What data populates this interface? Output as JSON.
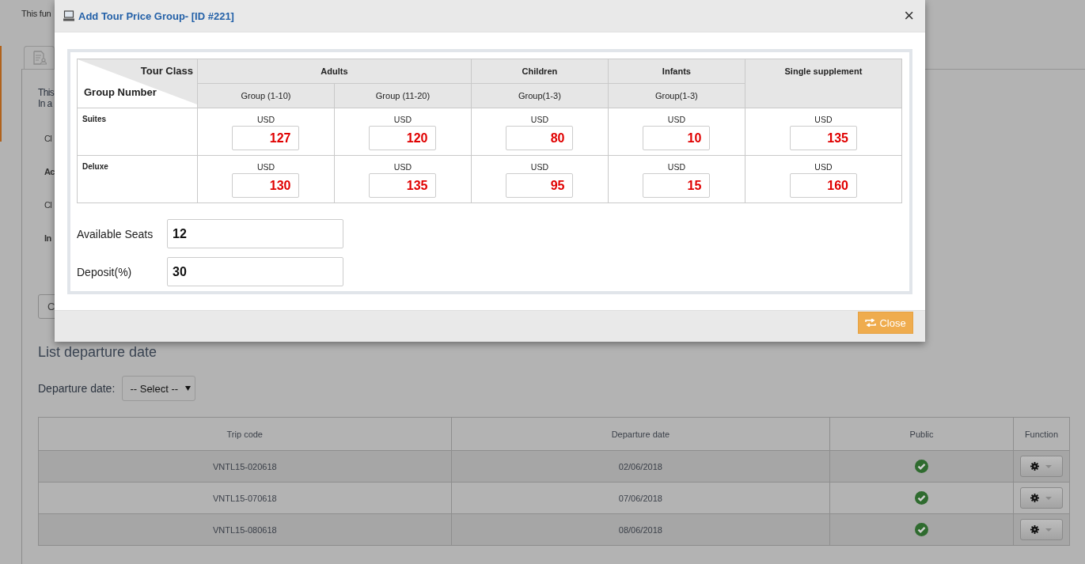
{
  "background": {
    "notice": "This fun",
    "intro_lines": [
      "This",
      "In a"
    ],
    "fields": [
      {
        "label": "Cl",
        "bold": false
      },
      {
        "label": "Ac",
        "bold": true
      },
      {
        "label": "Cl",
        "bold": false
      },
      {
        "label": "In",
        "bold": true
      }
    ],
    "button": "C",
    "list_title": "List departure date",
    "filter": {
      "label": "Departure date:",
      "value": "-- Select --"
    },
    "table": {
      "columns": [
        "Trip code",
        "Departure date",
        "Public",
        "Function"
      ],
      "rows": [
        {
          "trip_code": "VNTL15-020618",
          "departure_date": "02/06/2018",
          "public": true
        },
        {
          "trip_code": "VNTL15-070618",
          "departure_date": "07/06/2018",
          "public": true
        },
        {
          "trip_code": "VNTL15-080618",
          "departure_date": "08/06/2018",
          "public": true
        }
      ]
    }
  },
  "modal": {
    "title": "Add Tour Price Group- [ID #221]",
    "close_symbol": "×",
    "corner": {
      "top": "Tour Class",
      "bottom": "Group Number"
    },
    "columns": [
      {
        "label": "Adults",
        "groups": [
          "Group (1-10)",
          "Group (11-20)"
        ]
      },
      {
        "label": "Children",
        "groups": [
          "Group(1-3)"
        ]
      },
      {
        "label": "Infants",
        "groups": [
          "Group(1-3)"
        ]
      },
      {
        "label": "Single supplement"
      }
    ],
    "rows": [
      {
        "name": "Suites",
        "prices": [
          {
            "currency": "USD",
            "value": "127"
          },
          {
            "currency": "USD",
            "value": "120"
          },
          {
            "currency": "USD",
            "value": "80"
          },
          {
            "currency": "USD",
            "value": "10"
          },
          {
            "currency": "USD",
            "value": "135"
          }
        ]
      },
      {
        "name": "Deluxe",
        "prices": [
          {
            "currency": "USD",
            "value": "130"
          },
          {
            "currency": "USD",
            "value": "135"
          },
          {
            "currency": "USD",
            "value": "95"
          },
          {
            "currency": "USD",
            "value": "15"
          },
          {
            "currency": "USD",
            "value": "160"
          }
        ]
      }
    ],
    "fields": [
      {
        "label": "Available Seats",
        "value": "12"
      },
      {
        "label": "Deposit(%)",
        "value": "30"
      }
    ],
    "footer_button": "Close"
  }
}
